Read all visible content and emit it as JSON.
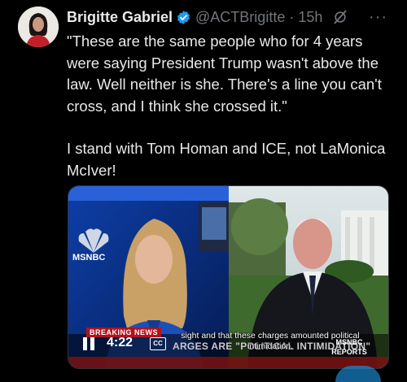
{
  "tweet": {
    "display_name": "Brigitte Gabriel",
    "handle": "@ACTBrigitte",
    "separator": "·",
    "time": "15h",
    "more_icon": "more-icon",
    "paragraphs": [
      "\"These are the same people who for 4 years were saying President Trump wasn't above the law. Well neither is she. There's a line you can't cross, and I think she crossed it.\"",
      "I stand with Tom Homan and ICE, not LaMonica McIver!"
    ]
  },
  "video": {
    "network": "MSNBC",
    "breaking_label": "BREAKING NEWS",
    "caption": "sight and that these charges amounted political intimidation.",
    "headline": "ARGES ARE \"POLITICAL INTIMIDATION\"",
    "reports_label_1": "MSNBC",
    "reports_label_2": "REPORTS",
    "duration": "4:22",
    "cc_label": "CC"
  },
  "colors": {
    "background": "#000000",
    "text": "#e7e9ea",
    "muted": "#71767b",
    "verified": "#1d9bf0"
  }
}
